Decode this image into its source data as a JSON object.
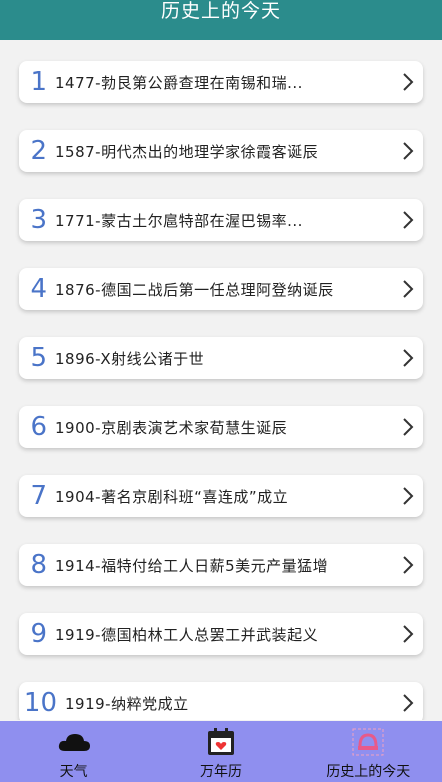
{
  "header": {
    "title": "历史上的今天"
  },
  "events": [
    {
      "num": "1",
      "text": "1477-勃艮第公爵查理在南锡和瑞..."
    },
    {
      "num": "2",
      "text": "1587-明代杰出的地理学家徐霞客诞辰"
    },
    {
      "num": "3",
      "text": "1771-蒙古土尔扈特部在渥巴锡率..."
    },
    {
      "num": "4",
      "text": "1876-德国二战后第一任总理阿登纳诞辰"
    },
    {
      "num": "5",
      "text": "1896-X射线公诸于世"
    },
    {
      "num": "6",
      "text": "1900-京剧表演艺术家荀慧生诞辰"
    },
    {
      "num": "7",
      "text": "1904-著名京剧科班“喜连成”成立"
    },
    {
      "num": "8",
      "text": "1914-福特付给工人日薪5美元产量猛增"
    },
    {
      "num": "9",
      "text": "1919-德国柏林工人总罢工并武装起义"
    },
    {
      "num": "10",
      "text": "1919-纳粹党成立"
    }
  ],
  "tabs": [
    {
      "label": "天气",
      "icon": "cloud-icon"
    },
    {
      "label": "万年历",
      "icon": "calendar-icon"
    },
    {
      "label": "历史上的今天",
      "icon": "history-icon"
    }
  ],
  "colors": {
    "header_bg": "#2b8c8c",
    "tabbar_bg": "#8f8fef",
    "number": "#4a74c8",
    "active_tab_icon": "#e85a8a"
  }
}
